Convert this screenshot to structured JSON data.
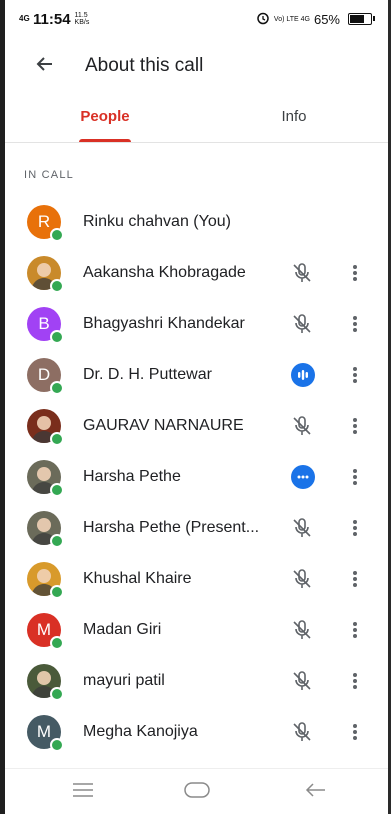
{
  "status_bar": {
    "network": "4G",
    "time": "11:54",
    "speed": "11.5 KB/s",
    "volte": "Vo) LTE 4G",
    "battery_text": "65%",
    "battery_level": 0.65
  },
  "header": {
    "title": "About this call"
  },
  "tabs": [
    {
      "label": "People",
      "active": true
    },
    {
      "label": "Info",
      "active": false
    }
  ],
  "section": {
    "label": "IN CALL"
  },
  "participants": [
    {
      "name": "Rinku chahvan (You)",
      "initial": "R",
      "avatar_color": "#e8710a",
      "photo": false,
      "mic": "none"
    },
    {
      "name": "Aakansha Khobragade",
      "initial": "",
      "avatar_color": "#c98a2a",
      "photo": true,
      "mic": "muted"
    },
    {
      "name": "Bhagyashri Khandekar",
      "initial": "B",
      "avatar_color": "#a142f4",
      "photo": false,
      "mic": "muted"
    },
    {
      "name": "Dr. D. H. Puttewar",
      "initial": "D",
      "avatar_color": "#8d6e63",
      "photo": false,
      "mic": "speaking"
    },
    {
      "name": "GAURAV NARNAURE",
      "initial": "",
      "avatar_color": "#7a2e1c",
      "photo": true,
      "mic": "muted"
    },
    {
      "name": "Harsha Pethe",
      "initial": "",
      "avatar_color": "#6b6b5a",
      "photo": true,
      "mic": "active"
    },
    {
      "name": "Harsha Pethe (Present...",
      "initial": "",
      "avatar_color": "#6b6b5a",
      "photo": true,
      "mic": "muted"
    },
    {
      "name": "Khushal Khaire",
      "initial": "",
      "avatar_color": "#d89a2b",
      "photo": true,
      "mic": "muted"
    },
    {
      "name": "Madan Giri",
      "initial": "M",
      "avatar_color": "#d93025",
      "photo": false,
      "mic": "muted"
    },
    {
      "name": "mayuri patil",
      "initial": "",
      "avatar_color": "#4a5a3a",
      "photo": true,
      "mic": "muted"
    },
    {
      "name": "Megha Kanojiya",
      "initial": "M",
      "avatar_color": "#455a64",
      "photo": false,
      "mic": "muted"
    }
  ],
  "colors": {
    "accent": "#d93025",
    "presence": "#34a853",
    "speaking": "#1a73e8"
  },
  "icons": {
    "back": "arrow-back-icon",
    "muted": "mic-off-icon",
    "speaking": "audio-level-icon",
    "active": "more-dots-circle-icon",
    "more": "more-vert-icon",
    "nav": [
      "menu-icon",
      "home-icon",
      "back-icon"
    ]
  }
}
